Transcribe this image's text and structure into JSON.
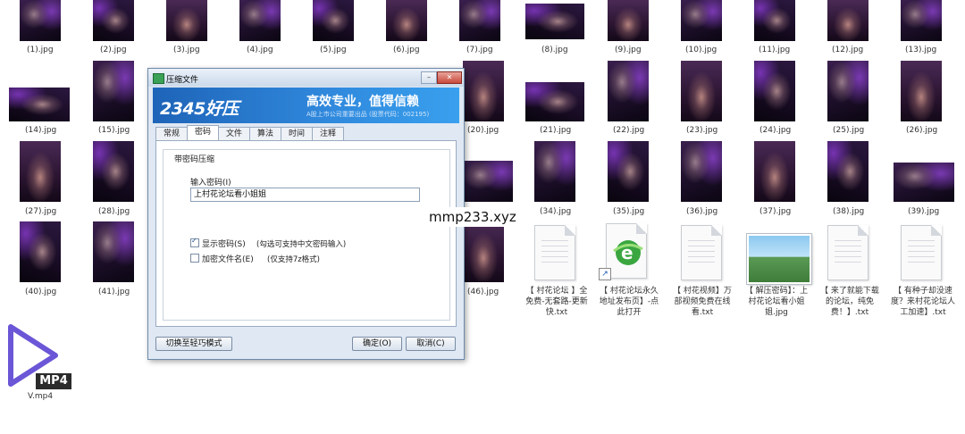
{
  "files_row1": [
    "(1).jpg",
    "(2).jpg",
    "(3).jpg",
    "(4).jpg",
    "(5).jpg",
    "(6).jpg",
    "(7).jpg",
    "(8).jpg",
    "(9).jpg",
    "(10).jpg",
    "(11).jpg",
    "(12).jpg",
    "(13).jpg"
  ],
  "files_row2": [
    "(14).jpg",
    "(15).jpg",
    "(20).jpg",
    "(21).jpg",
    "(22).jpg",
    "(23).jpg",
    "(24).jpg",
    "(25).jpg",
    "(26).jpg"
  ],
  "files_row3": [
    "(27).jpg",
    "(28).jpg",
    "(34).jpg",
    "(35).jpg",
    "(36).jpg",
    "(37).jpg",
    "(38).jpg",
    "(39).jpg"
  ],
  "files_row4": [
    "(40).jpg",
    "(41).jpg",
    "(46).jpg"
  ],
  "text_files": [
    "【 村花论坛 】全免费-无套路-更新快.txt",
    "【 村花论坛永久地址发布页】-点此打开",
    "【 村花视频】万部视频免费在线看.txt",
    "【 解压密码】：上村花论坛看小姐姐.jpg",
    "【 来了就能下载的论坛，纯免费！】.txt",
    "【 有种子却没速度？来村花论坛人工加速】.txt"
  ],
  "video_file": {
    "label": "V.mp4",
    "badge": "MP4"
  },
  "watermark": "mmp233.xyz",
  "dialog": {
    "title": "压缩文件",
    "logo": "2345好压",
    "slogan": "高效专业，值得信赖",
    "subline": "A股上市公司重要出品 (股票代码：002195)",
    "tabs": [
      "常规",
      "密码",
      "文件",
      "算法",
      "时间",
      "注释"
    ],
    "active_tab": "密码",
    "group_title": "带密码压缩",
    "password_label": "输入密码(I)",
    "password_value": "上村花论坛看小姐姐",
    "show_password_label": "显示密码(S)",
    "show_password_hint": "(勾选可支持中文密码输入)",
    "encrypt_names_label": "加密文件名(E)",
    "encrypt_names_hint": "(仅支持7z格式)",
    "show_password_checked": true,
    "encrypt_names_checked": false,
    "switch_mode_button": "切换至轻巧模式",
    "ok_button": "确定(O)",
    "cancel_button": "取消(C)",
    "minimize": "–",
    "close": "✕"
  }
}
